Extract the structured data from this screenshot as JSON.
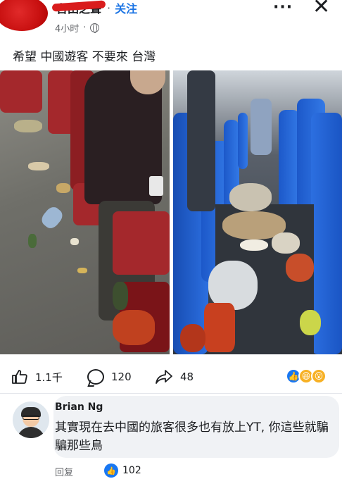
{
  "post": {
    "author_name": "台田之聲",
    "follow_label": "关注",
    "time": "4小时",
    "separator": "·",
    "more_glyph": "···",
    "close_glyph": "✕",
    "text": "希望 中國遊客 不要來 台灣"
  },
  "photos": {
    "left_image": "train-interior-red-seats-litter",
    "right_image": "train-interior-blue-seats-litter"
  },
  "actions": {
    "like_count": "1.1千",
    "comment_count": "120",
    "share_count": "48"
  },
  "reactions": {
    "like_icon": "like-reaction-icon",
    "haha_icon": "haha-reaction-icon",
    "wow_icon": "wow-reaction-icon"
  },
  "comment": {
    "author": "Brian Ng",
    "text": "其實現在去中國的旅客很多也有放上YT, 你這些就騙騙那些鳥",
    "reply_label": "回复",
    "like_count": "102"
  },
  "colors": {
    "accent_blue": "#1b74e4",
    "red_seat": "#a4282c",
    "blue_seat": "#2a6bdc"
  }
}
